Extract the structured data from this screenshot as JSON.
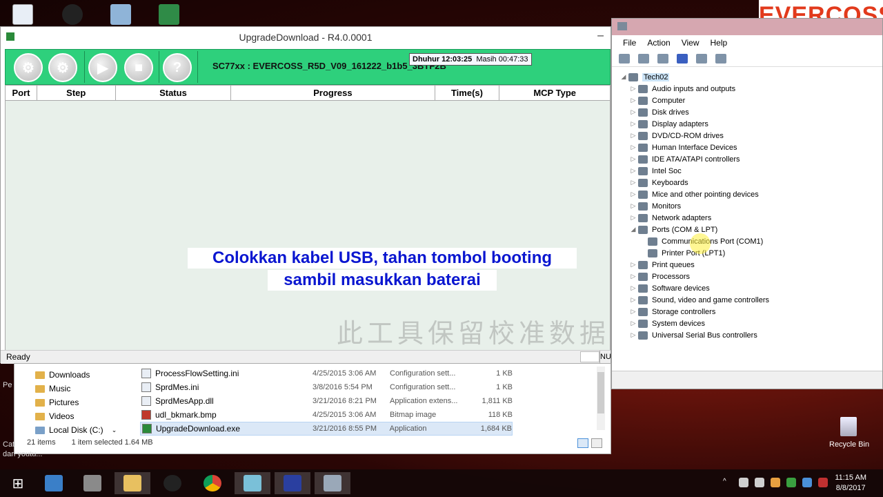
{
  "brand": "EVERCOSS",
  "upgrade": {
    "title": "UpgradeDownload - R4.0.0001",
    "firmware": "SC77xx : EVERCOSS_R5D_V09_161222_b1b5_3BTF2B",
    "tooltip_label": "Dhuhur 12:03:25",
    "tooltip_rest": "Masih 00:47:33",
    "columns": [
      "Port",
      "Step",
      "Status",
      "Progress",
      "Time(s)",
      "MCP Type"
    ],
    "status": "Ready",
    "status_right": "NU"
  },
  "subtitle": {
    "line1": "Colokkan kabel USB, tahan tombol booting",
    "line2": "sambil masukkan baterai"
  },
  "watermark_cn": "此工具保留校准数据",
  "explorer": {
    "nav": [
      "Downloads",
      "Music",
      "Pictures",
      "Videos",
      "Local Disk (C:)"
    ],
    "files": [
      {
        "name": "ProcessFlowSetting.ini",
        "date": "4/25/2015 3:06 AM",
        "type": "Configuration sett...",
        "size": "1 KB"
      },
      {
        "name": "SprdMes.ini",
        "date": "3/8/2016 5:54 PM",
        "type": "Configuration sett...",
        "size": "1 KB"
      },
      {
        "name": "SprdMesApp.dll",
        "date": "3/21/2016 8:21 PM",
        "type": "Application extens...",
        "size": "1,811 KB"
      },
      {
        "name": "udl_bkmark.bmp",
        "date": "4/25/2015 3:06 AM",
        "type": "Bitmap image",
        "size": "118 KB"
      },
      {
        "name": "UpgradeDownload.exe",
        "date": "3/21/2016 8:55 PM",
        "type": "Application",
        "size": "1,684 KB"
      }
    ],
    "items_count": "21 items",
    "selection": "1 item selected  1.64 MB"
  },
  "devmgr": {
    "menu": [
      "File",
      "Action",
      "View",
      "Help"
    ],
    "root": "Tech02",
    "nodes": [
      "Audio inputs and outputs",
      "Computer",
      "Disk drives",
      "Display adapters",
      "DVD/CD-ROM drives",
      "Human Interface Devices",
      "IDE ATA/ATAPI controllers",
      "Intel Soc",
      "Keyboards",
      "Mice and other pointing devices",
      "Monitors",
      "Network adapters",
      "Ports (COM & LPT)"
    ],
    "ports_children": [
      "Communications Port (COM1)",
      "Printer Port (LPT1)"
    ],
    "nodes_after": [
      "Print queues",
      "Processors",
      "Software devices",
      "Sound, video and game controllers",
      "Storage controllers",
      "System devices",
      "Universal Serial Bus controllers"
    ]
  },
  "desktop": {
    "recycle_bin": "Recycle Bin",
    "left_text_1": "Pe",
    "left_text_2": "Cat",
    "left_text_3": "dari youtu..."
  },
  "taskbar": {
    "time": "11:15 AM",
    "date": "8/8/2017"
  },
  "colors": {
    "toolbar_green": "#2ed07c",
    "subtitle_blue": "#0a16d0",
    "brand_red": "#e23a1c"
  }
}
